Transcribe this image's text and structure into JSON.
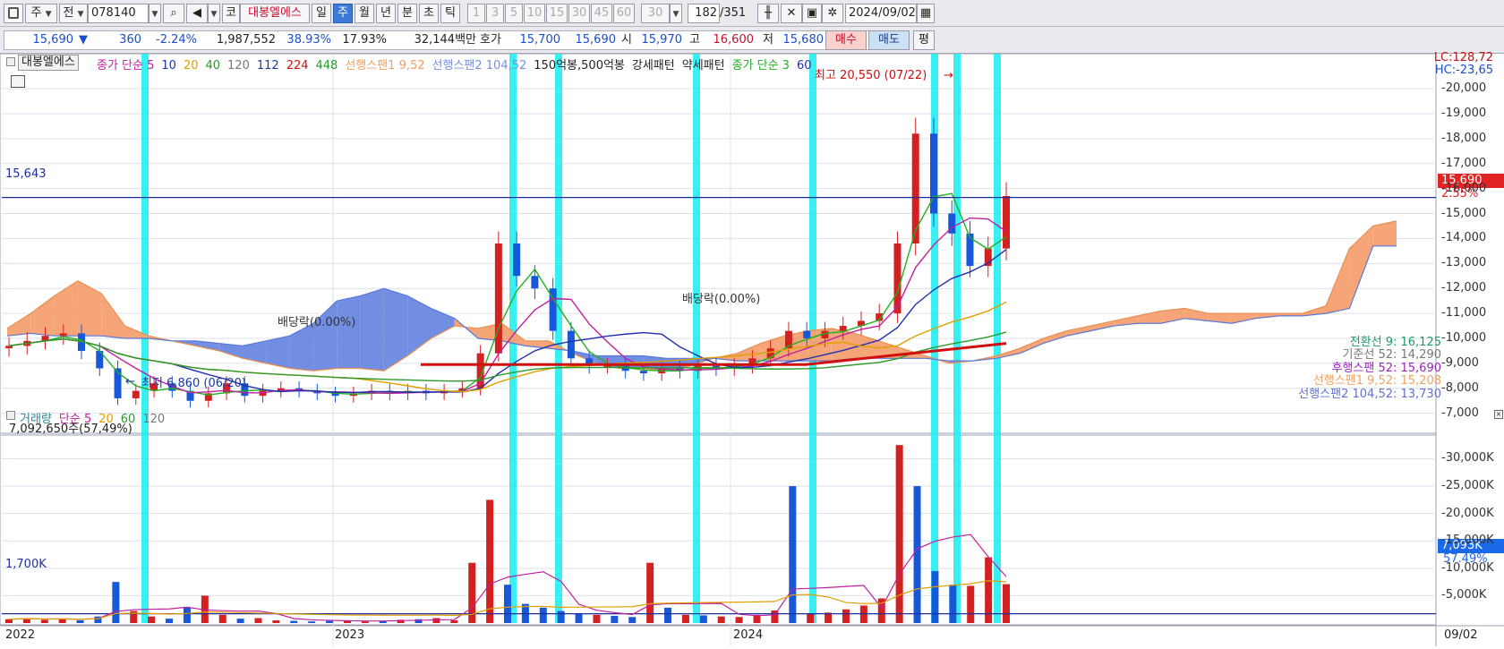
{
  "toolbar": {
    "type_select": "주",
    "prev_label": "전",
    "code": "078140",
    "market_btn": "코",
    "stock_name": "대봉엘에스",
    "periods": [
      {
        "label": "일",
        "selected": false
      },
      {
        "label": "주",
        "selected": true
      },
      {
        "label": "월",
        "selected": false
      },
      {
        "label": "년",
        "selected": false
      },
      {
        "label": "분",
        "selected": false
      },
      {
        "label": "초",
        "selected": false
      },
      {
        "label": "틱",
        "selected": false
      }
    ],
    "intervals": [
      "1",
      "3",
      "5",
      "10",
      "15",
      "30",
      "45",
      "60"
    ],
    "interval_value": "30",
    "count": "182",
    "total": "/351",
    "date": "2024/09/02"
  },
  "quote": {
    "price": "15,690",
    "change_arrow": "▼",
    "change": "360",
    "change_pct": "-2.24%",
    "volume": "1,987,552",
    "ratio1": "38.93%",
    "ratio2": "17.93%",
    "amount": "32,144백만",
    "hoga_label": "호가",
    "ask": "15,700",
    "bid": "15,690",
    "open_label": "시",
    "open": "15,970",
    "high_label": "고",
    "high": "16,600",
    "low_label": "저",
    "low": "15,680",
    "buy_label": "매수",
    "sell_label": "매도",
    "eval_label": "평"
  },
  "price_panel": {
    "name_tag": "대봉엘에스",
    "legend": [
      {
        "text": "종가 단순 5",
        "color": "#c020a0"
      },
      {
        "text": "10",
        "color": "#2030b0"
      },
      {
        "text": "20",
        "color": "#e0a000"
      },
      {
        "text": "40",
        "color": "#2a9a2a"
      },
      {
        "text": "120",
        "color": "#777777"
      },
      {
        "text": "112",
        "color": "#1a3aa0"
      },
      {
        "text": "224",
        "color": "#d01010"
      },
      {
        "text": "448",
        "color": "#2a9a2a"
      },
      {
        "text": "선행스팬1 9,52",
        "color": "#f0a060"
      },
      {
        "text": "선행스팬2 104,52",
        "color": "#7890e0"
      },
      {
        "text": "150억봉,500억봉",
        "color": "#222222"
      },
      {
        "text": "강세패턴",
        "color": "#222222"
      },
      {
        "text": "약세패턴",
        "color": "#222222"
      },
      {
        "text": "종가 단순 3",
        "color": "#20b020"
      },
      {
        "text": "60",
        "color": "#2030b0"
      }
    ],
    "ref_line": "15,643",
    "annotations": {
      "high": "최고 20,550 (07/22)",
      "low": "최저 6,860 (06/20)",
      "dividend1": "배당락(0.00%)",
      "dividend2": "배당락(0.00%)"
    },
    "lc": "LC:128,72",
    "hc": "HC:-23,65",
    "price_tag": "15,690",
    "pct_tag": "2.55%",
    "ichimoku": [
      {
        "text": "전환선 9: 16,125",
        "color": "#1a9a6a"
      },
      {
        "text": "기준선 52: 14,290",
        "color": "#777777"
      },
      {
        "text": "후행스팬 52: 15,690",
        "color": "#a020c0"
      },
      {
        "text": "선행스팬1 9,52: 15,208",
        "color": "#f0a060"
      },
      {
        "text": "선행스팬2 104,52: 13,730",
        "color": "#6070d0"
      }
    ]
  },
  "volume_panel": {
    "legend": [
      {
        "text": "거래량",
        "color": "#2a8aa0"
      },
      {
        "text": "단순 5",
        "color": "#c020a0"
      },
      {
        "text": "20",
        "color": "#e0a000"
      },
      {
        "text": "60",
        "color": "#2a9a2a"
      },
      {
        "text": "120",
        "color": "#777777"
      }
    ],
    "last": "7,092,650주(57,49%)",
    "ref_line": "1,700K",
    "vol_tag": "7,093K",
    "vol_pct": "57.49%"
  },
  "x_axis": {
    "labels": [
      "2022",
      "2023",
      "2024"
    ],
    "right_date": "09/02"
  },
  "colors": {
    "up": "#d32020",
    "down": "#1858d8",
    "highlight": "#22eef0",
    "grid": "#dde0ea",
    "cloud_bull": "#f4a070",
    "cloud_bear": "#6a88e0"
  },
  "chart_data": [
    {
      "type": "line",
      "title": "대봉엘에스 주봉",
      "y_ticks": [
        7000,
        8000,
        9000,
        10000,
        11000,
        12000,
        13000,
        14000,
        15000,
        16000,
        17000,
        18000,
        19000,
        20000
      ],
      "y_tick_labels": [
        "7,000",
        "8,000",
        "9,000",
        "10,000",
        "11,000",
        "12,000",
        "13,000",
        "14,000",
        "15,000",
        "16,000",
        "17,000",
        "18,000",
        "19,000",
        "20,000"
      ],
      "ylim": [
        6200,
        21400
      ],
      "x_labels": [
        "2022",
        "2023",
        "2024"
      ],
      "grid": true,
      "series": [
        {
          "name": "종가",
          "values": [
            9700,
            9900,
            10100,
            10200,
            9500,
            8800,
            7600,
            7900,
            8200,
            7900,
            7500,
            7800,
            8200,
            7700,
            7900,
            8000,
            7900,
            7800,
            7700,
            7800,
            7900,
            7800,
            7900,
            7800,
            7900,
            8000,
            9400,
            13800,
            12500,
            12000,
            10300,
            9200,
            8900,
            8900,
            8700,
            8600,
            8800,
            8700,
            8900,
            8800,
            8900,
            9200,
            9600,
            10300,
            10000,
            10300,
            10500,
            10700,
            11000,
            13800,
            18200,
            15000,
            14200,
            12900,
            13600,
            15700
          ]
        },
        {
          "name": "선행스팬1",
          "values": [
            10400,
            11000,
            11700,
            12300,
            11800,
            10500,
            10100,
            9900,
            9700,
            9500,
            9200,
            9000,
            8800,
            8700,
            8800,
            8800,
            8700,
            9300,
            10000,
            10500,
            10400,
            10600,
            9900,
            9900,
            9400,
            9000,
            8800,
            8800,
            8700,
            8900,
            9200,
            9400,
            9800,
            10100,
            10300,
            10400,
            10200,
            9900,
            9600,
            9300,
            9000,
            9100,
            9300,
            9600,
            10000,
            10300,
            10500,
            10700,
            10900,
            11100,
            11200,
            11000,
            11000,
            11000,
            11000,
            11000,
            11300,
            13600,
            14500,
            14700
          ]
        },
        {
          "name": "선행스팬2",
          "values": [
            10100,
            10200,
            10100,
            10100,
            10100,
            10000,
            10000,
            9900,
            9900,
            9800,
            9700,
            9900,
            10100,
            10600,
            11500,
            11700,
            12000,
            11700,
            11200,
            10800,
            10000,
            9900,
            9700,
            9600,
            9500,
            9300,
            9300,
            9300,
            9200,
            9200,
            9200,
            9100,
            9100,
            9100,
            9100,
            9100,
            9200,
            9200,
            9200,
            9200,
            9100,
            9100,
            9200,
            9400,
            9800,
            10100,
            10300,
            10500,
            10600,
            10600,
            10800,
            10700,
            10600,
            10800,
            10900,
            10900,
            11000,
            11200,
            13700,
            13700
          ]
        }
      ]
    },
    {
      "type": "bar",
      "title": "거래량",
      "y_ticks": [
        5000,
        10000,
        15000,
        20000,
        25000,
        30000
      ],
      "y_tick_labels": [
        "5,000K",
        "10,000K",
        "15,000K",
        "20,000K",
        "25,000K",
        "30,000K"
      ],
      "ylim": [
        0,
        34000
      ],
      "series": [
        {
          "name": "거래량",
          "values": [
            700,
            900,
            600,
            800,
            500,
            1200,
            7500,
            2200,
            1200,
            800,
            2800,
            5000,
            1500,
            800,
            900,
            500,
            400,
            300,
            400,
            500,
            300,
            400,
            600,
            700,
            900,
            500,
            11000,
            22500,
            7000,
            3500,
            2800,
            2200,
            1700,
            1500,
            1300,
            1100,
            11000,
            2800,
            1500,
            1400,
            1200,
            1100,
            1500,
            2300,
            25000,
            1700,
            1900,
            2500,
            3200,
            4500,
            32500,
            25000,
            9500,
            7000,
            6800,
            12000,
            7100
          ]
        }
      ]
    }
  ]
}
